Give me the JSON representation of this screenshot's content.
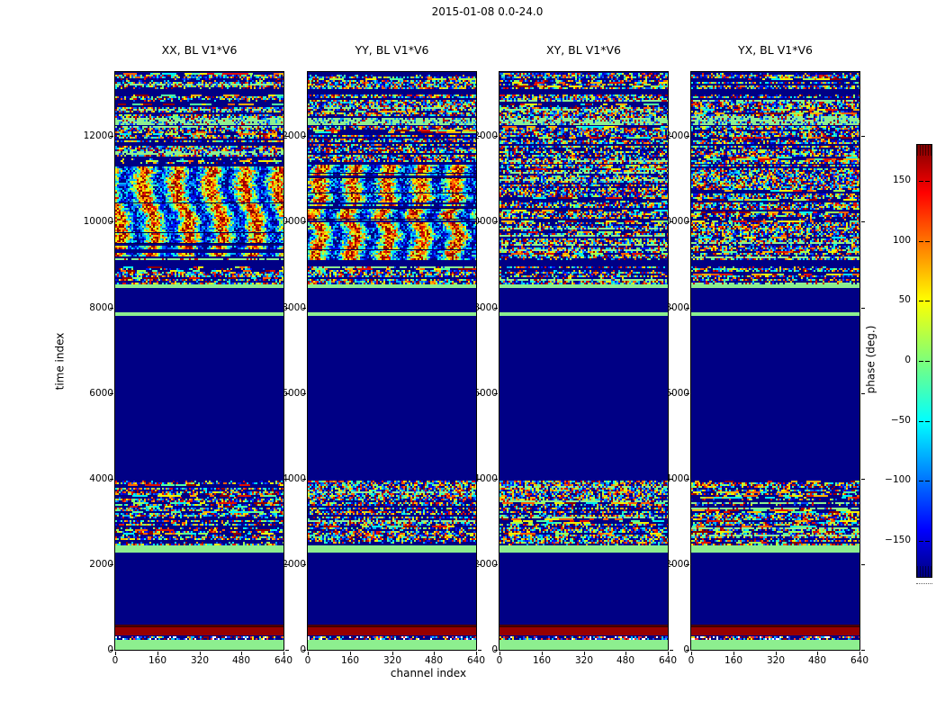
{
  "figure": {
    "title": "2015-01-08 0.0-24.0",
    "background": "#ffffff"
  },
  "chart_data": {
    "type": "heatmap",
    "figure_title": "2015-01-08 0.0-24.0",
    "xlabel": "channel index",
    "ylabel": "time index",
    "xlim": [
      0,
      640
    ],
    "ylim": [
      0,
      13500
    ],
    "x_ticks": [
      0,
      160,
      320,
      480,
      640
    ],
    "y_ticks": [
      0,
      2000,
      4000,
      6000,
      8000,
      10000,
      12000
    ],
    "panels": [
      {
        "title": "XX, BL V1*V6",
        "pattern": "coherent-wavy",
        "seed": 11
      },
      {
        "title": "YY, BL V1*V6",
        "pattern": "coherent-wavy",
        "seed": 23
      },
      {
        "title": "XY, BL V1*V6",
        "pattern": "random-noise",
        "seed": 37
      },
      {
        "title": "YX, BL V1*V6",
        "pattern": "random-noise",
        "seed": 51
      }
    ],
    "bands": [
      {
        "t0": 0,
        "t1": 230,
        "type": "green"
      },
      {
        "t0": 230,
        "t1": 340,
        "type": "fine"
      },
      {
        "t0": 340,
        "t1": 545,
        "type": "darkred"
      },
      {
        "t0": 545,
        "t1": 590,
        "type": "maroon"
      },
      {
        "t0": 590,
        "t1": 2280,
        "type": "navy"
      },
      {
        "t0": 2280,
        "t1": 2440,
        "type": "green"
      },
      {
        "t0": 2440,
        "t1": 3960,
        "type": "striped"
      },
      {
        "t0": 3960,
        "t1": 7800,
        "type": "navy"
      },
      {
        "t0": 7800,
        "t1": 7890,
        "type": "green"
      },
      {
        "t0": 7890,
        "t1": 8450,
        "type": "navy"
      },
      {
        "t0": 8450,
        "t1": 8540,
        "type": "green"
      },
      {
        "t0": 8540,
        "t1": 8950,
        "type": "striped"
      },
      {
        "t0": 8950,
        "t1": 9110,
        "type": "navy"
      },
      {
        "t0": 9110,
        "t1": 11350,
        "type": "wavy"
      },
      {
        "t0": 11350,
        "t1": 12250,
        "type": "striped"
      },
      {
        "t0": 12250,
        "t1": 12430,
        "type": "green_speck"
      },
      {
        "t0": 12430,
        "t1": 12970,
        "type": "striped"
      },
      {
        "t0": 12970,
        "t1": 13110,
        "type": "navy"
      },
      {
        "t0": 13110,
        "t1": 13500,
        "type": "striped"
      }
    ],
    "colorbar": {
      "label": "phase (deg.)",
      "range": [
        -180,
        180
      ],
      "ticks": [
        -150,
        -100,
        -50,
        0,
        50,
        100,
        150
      ],
      "colormap": "jet"
    },
    "colors": {
      "background": "#ffffff",
      "frame": "#000000",
      "navy": "#000085",
      "green": "#8def8f",
      "darkred": "#970000",
      "maroon": "#4a0000",
      "jet_palette": [
        "#000080",
        "#0000c4",
        "#0010ff",
        "#0060ff",
        "#00b0ff",
        "#00f0f0",
        "#50ffa0",
        "#a0ff50",
        "#f0f000",
        "#ffb000",
        "#ff6000",
        "#e01000",
        "#900000"
      ],
      "fine_palette": [
        "#ffffff",
        "#ff3030",
        "#2040ff",
        "#00c0ff",
        "#ffe000",
        "#900000"
      ]
    }
  }
}
